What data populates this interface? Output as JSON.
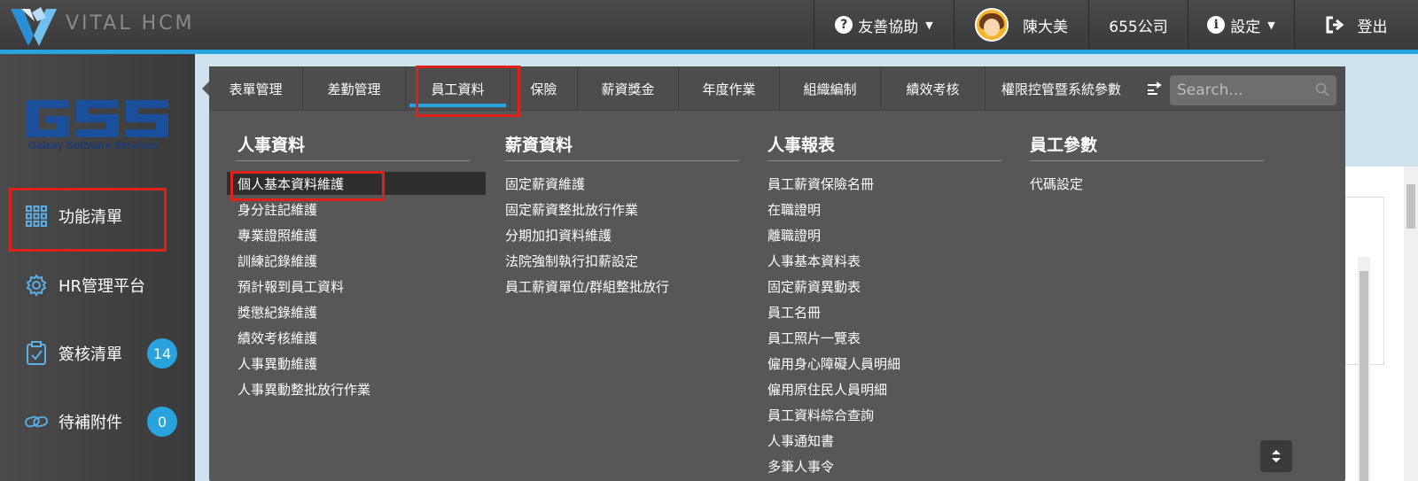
{
  "app": {
    "brand": "VITAL HCM"
  },
  "header": {
    "help": "友善協助",
    "user_name": "陳大美",
    "company": "655公司",
    "settings": "設定",
    "logout": "登出"
  },
  "sidebar": {
    "logo_text": "GSS",
    "logo_sub": "Galaxy Software Services",
    "items": [
      {
        "label": "功能清單",
        "icon": "grid-icon"
      },
      {
        "label": "HR管理平台",
        "icon": "gear-icon"
      },
      {
        "label": "簽核清單",
        "icon": "clipboard-check-icon",
        "badge": "14"
      },
      {
        "label": "待補附件",
        "icon": "link-icon",
        "badge": "0"
      }
    ]
  },
  "menu": {
    "tabs": [
      "表單管理",
      "差勤管理",
      "員工資料",
      "保險",
      "薪資獎金",
      "年度作業",
      "組織編制",
      "績效考核",
      "權限控管暨系統參數"
    ],
    "active_tab": "員工資料",
    "search_placeholder": "Search...",
    "columns": [
      {
        "title": "人事資料",
        "items": [
          "個人基本資料維護",
          "身分註記維護",
          "專業證照維護",
          "訓練記錄維護",
          "預計報到員工資料",
          "獎懲紀錄維護",
          "績效考核維護",
          "人事異動維護",
          "人事異動整批放行作業"
        ]
      },
      {
        "title": "薪資資料",
        "items": [
          "固定薪資維護",
          "固定薪資整批放行作業",
          "分期加扣資料維護",
          "法院強制執行扣薪設定",
          "員工薪資單位/群組整批放行"
        ]
      },
      {
        "title": "人事報表",
        "items": [
          "員工薪資保險名冊",
          "在職證明",
          "離職證明",
          "人事基本資料表",
          "固定薪資異動表",
          "員工名冊",
          "員工照片一覽表",
          "僱用身心障礙人員明細",
          "僱用原住民人員明細",
          "員工資料綜合查詢",
          "人事通知書",
          "多筆人事令"
        ]
      },
      {
        "title": "員工參數",
        "items": [
          "代碼設定"
        ]
      }
    ]
  },
  "colors": {
    "accent": "#29a3de",
    "highlight_box": "#e0201b",
    "panel": "#575757",
    "topbar": "#404040"
  }
}
